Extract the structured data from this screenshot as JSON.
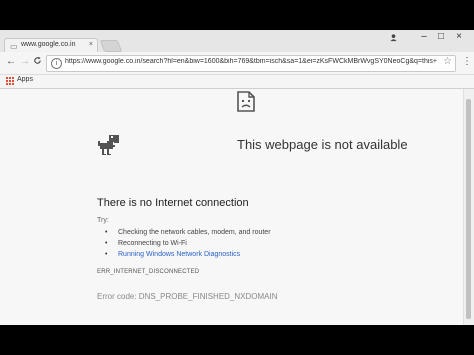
{
  "browser": {
    "tab": {
      "title": "www.google.co.in",
      "close": "×"
    },
    "window_buttons": {
      "minimize": "–",
      "maximize": "□",
      "close": "×"
    },
    "nav": {
      "back": "←",
      "forward": "→",
      "reload": "C"
    },
    "omnibox": {
      "url": "https://www.google.co.in/search?hl=en&biw=1600&bih=769&tbm=isch&sa=1&ei=zKsFWCkMBrWvgSY0NeoCg&q=this+pa..."
    },
    "star": "☆",
    "menu": "⋮",
    "bookmarks": {
      "apps_label": "Apps"
    }
  },
  "error_page": {
    "title": "This webpage is not available",
    "headline": "There is no Internet connection",
    "try_label": "Try:",
    "suggestions": [
      "Checking the network cables, modem, and router",
      "Reconnecting to Wi-Fi",
      "Running Windows Network Diagnostics"
    ],
    "error_code_small": "ERR_INTERNET_DISCONNECTED",
    "error_code": "Error code: DNS_PROBE_FINISHED_NXDOMAIN"
  },
  "colors": {
    "link": "#2962c9",
    "apps_red": "#e04b3a"
  },
  "icons": {
    "tab": "page-icon",
    "info": "info-icon",
    "star": "star-icon",
    "menu": "kebab-menu-icon",
    "profile": "profile-icon",
    "sad_tab": "sad-page-icon",
    "dino": "dinosaur-icon"
  }
}
